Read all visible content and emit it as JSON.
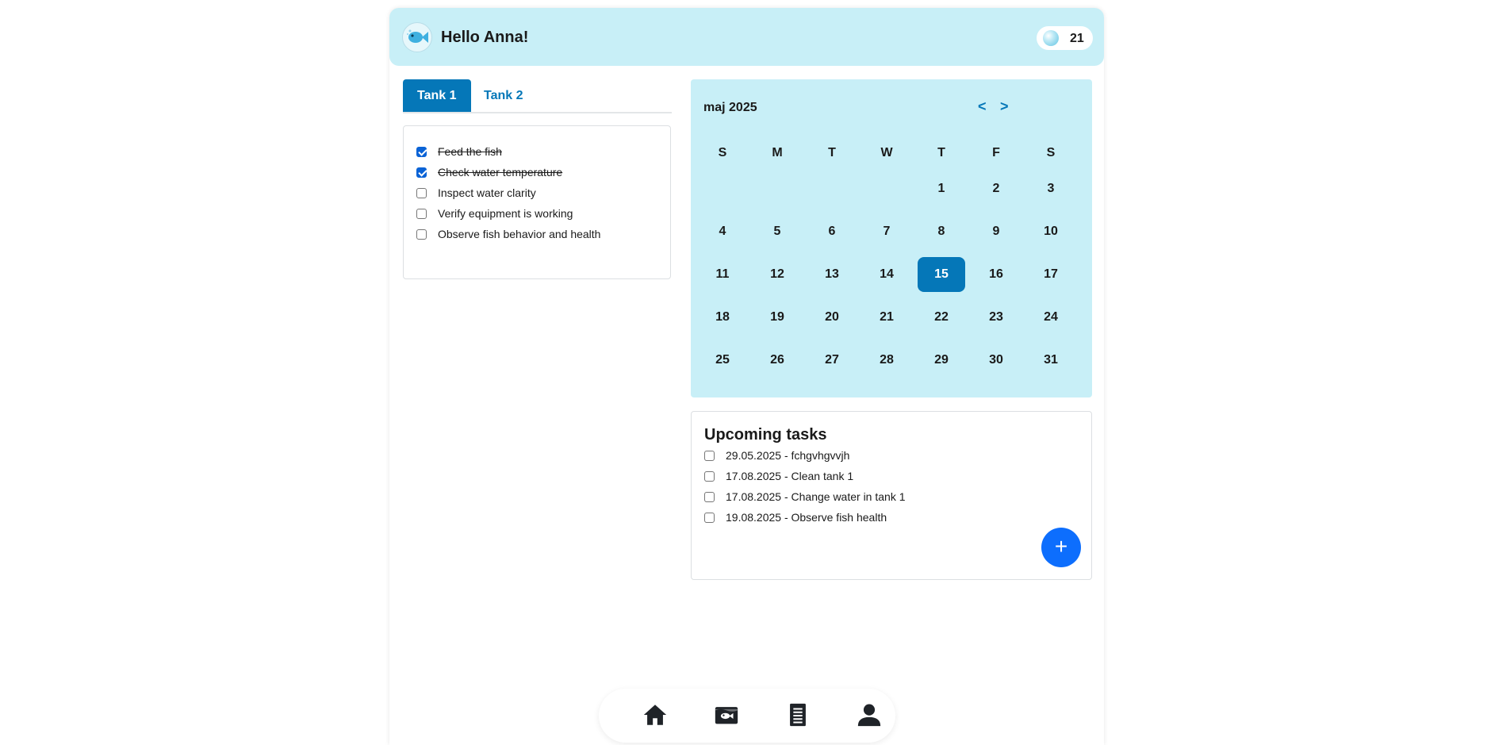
{
  "header": {
    "greeting": "Hello Anna!",
    "bubble_count": "21",
    "logo_icon": "fish-logo-icon",
    "bubble_icon": "bubble-icon"
  },
  "tabs": [
    {
      "label": "Tank 1",
      "active": true
    },
    {
      "label": "Tank 2",
      "active": false
    }
  ],
  "checklist": [
    {
      "label": "Feed the fish",
      "checked": true
    },
    {
      "label": "Check water temperature",
      "checked": true
    },
    {
      "label": "Inspect water clarity",
      "checked": false
    },
    {
      "label": "Verify equipment is working",
      "checked": false
    },
    {
      "label": "Observe fish behavior and health",
      "checked": false
    }
  ],
  "calendar": {
    "month_label": "maj 2025",
    "prev_label": "<",
    "next_label": ">",
    "weekdays": [
      "S",
      "M",
      "T",
      "W",
      "T",
      "F",
      "S"
    ],
    "weeks": [
      [
        "",
        "",
        "",
        "",
        "1",
        "2",
        "3"
      ],
      [
        "4",
        "5",
        "6",
        "7",
        "8",
        "9",
        "10"
      ],
      [
        "11",
        "12",
        "13",
        "14",
        "15",
        "16",
        "17"
      ],
      [
        "18",
        "19",
        "20",
        "21",
        "22",
        "23",
        "24"
      ],
      [
        "25",
        "26",
        "27",
        "28",
        "29",
        "30",
        "31"
      ]
    ],
    "selected_day": "15"
  },
  "upcoming": {
    "title": "Upcoming tasks",
    "items": [
      {
        "label": "29.05.2025 - fchgvhgvvjh",
        "checked": false
      },
      {
        "label": "17.08.2025 - Clean tank 1",
        "checked": false
      },
      {
        "label": "17.08.2025 - Change water in tank 1",
        "checked": false
      },
      {
        "label": "19.08.2025 - Observe fish health",
        "checked": false
      }
    ],
    "add_label": "+"
  },
  "bottom_nav": [
    {
      "icon": "home-icon"
    },
    {
      "icon": "aquarium-icon"
    },
    {
      "icon": "document-icon"
    },
    {
      "icon": "profile-icon"
    }
  ],
  "colors": {
    "accent": "#0577b8",
    "header_bg": "#c8eff7",
    "fab": "#0d6efd",
    "checkbox_checked": "#0b63d6"
  }
}
